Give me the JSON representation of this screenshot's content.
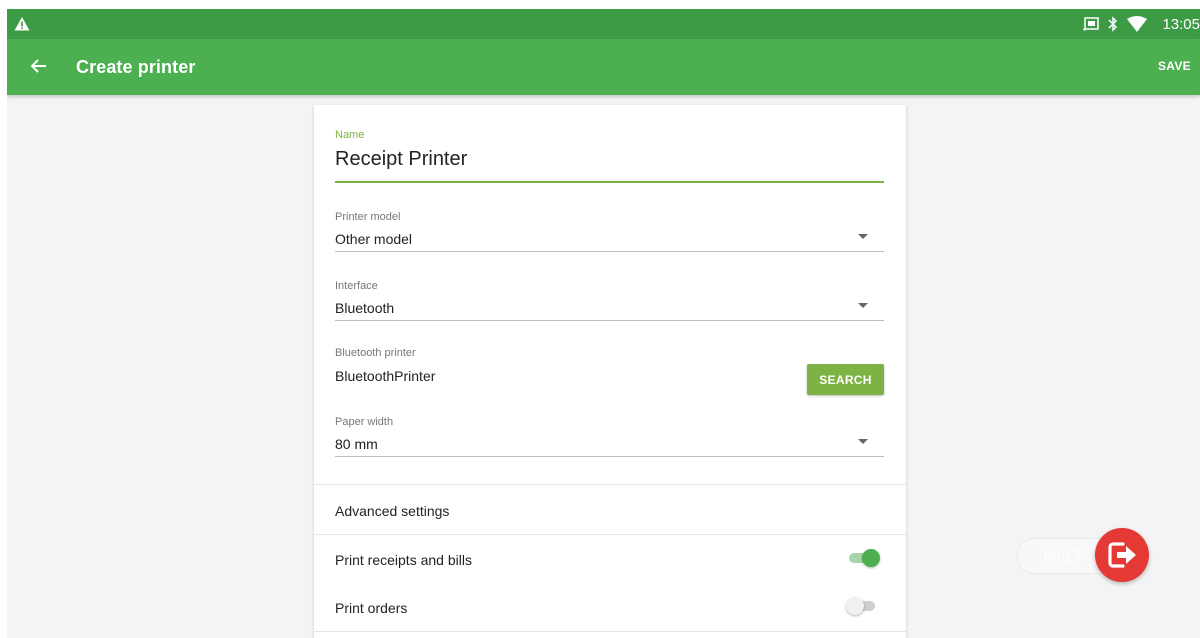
{
  "status_bar": {
    "time": "13:05",
    "icons": [
      "alert-icon",
      "cast-icon",
      "bluetooth-icon",
      "wifi-icon"
    ]
  },
  "app_bar": {
    "title": "Create printer",
    "save_label": "SAVE",
    "back_icon": "arrow-back-icon"
  },
  "form": {
    "name": {
      "label": "Name",
      "value": "Receipt Printer"
    },
    "printer_model": {
      "label": "Printer model",
      "value": "Other model"
    },
    "interface": {
      "label": "Interface",
      "value": "Bluetooth"
    },
    "bluetooth_printer": {
      "label": "Bluetooth printer",
      "value": "BluetoothPrinter",
      "button_label": "SEARCH"
    },
    "paper_width": {
      "label": "Paper width",
      "value": "80 mm"
    }
  },
  "advanced": {
    "header": "Advanced settings",
    "toggles": [
      {
        "label": "Print receipts and bills",
        "on": true
      },
      {
        "label": "Print orders",
        "on": false
      }
    ]
  },
  "overlay": {
    "timer_text": "09:17",
    "exit_icon": "exit-icon"
  },
  "colors": {
    "status_bar": "#3d9a45",
    "app_bar": "#4caf50",
    "accent": "#7cb342",
    "exit_button": "#e53935",
    "background": "#f4f4f4"
  }
}
